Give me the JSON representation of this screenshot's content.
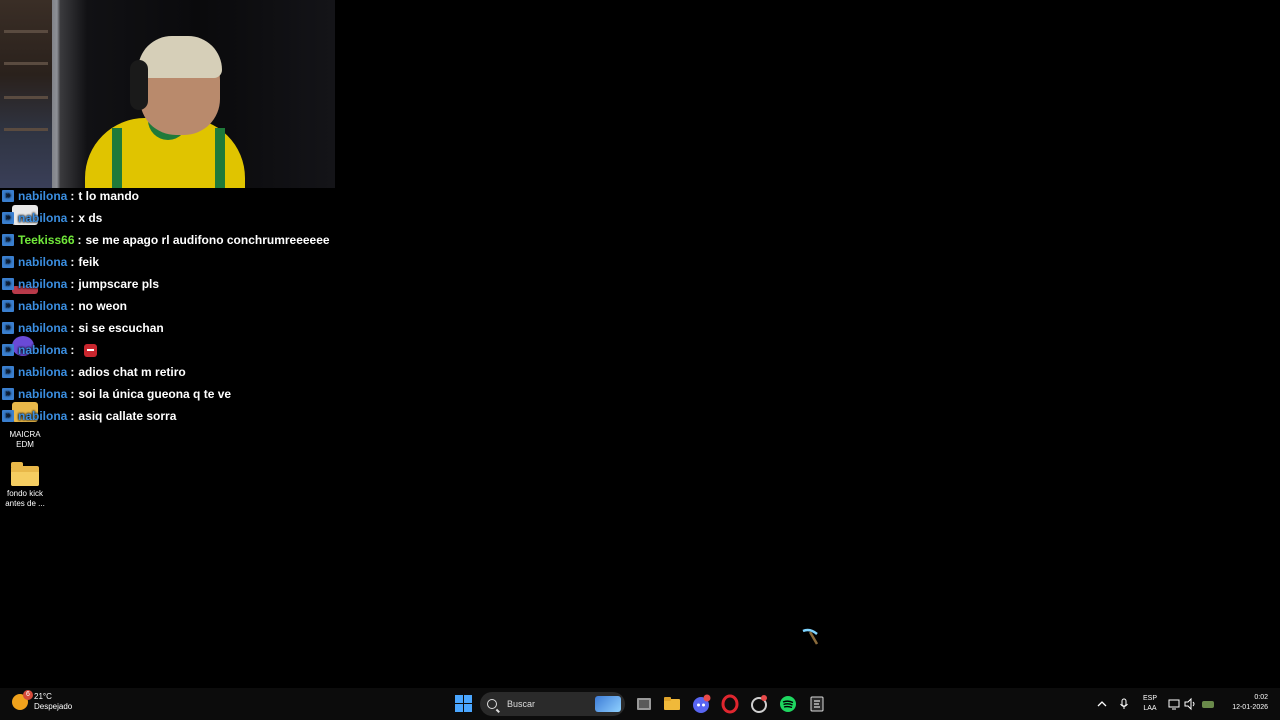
{
  "chat": {
    "messages": [
      {
        "user": "nabilona",
        "text": "t lo mando"
      },
      {
        "user": "nabilona",
        "text": "x ds"
      },
      {
        "user": "Teekiss66",
        "text": "se me apago rl audifono conchrumreeeeee"
      },
      {
        "user": "nabilona",
        "text": "feik"
      },
      {
        "user": "nabilona",
        "text": "jumpscare pls"
      },
      {
        "user": "nabilona",
        "text": "no weon"
      },
      {
        "user": "nabilona",
        "text": "si se escuchan"
      },
      {
        "user": "nabilona",
        "text": ""
      },
      {
        "user": "nabilona",
        "text": "adios chat m retiro"
      },
      {
        "user": "nabilona",
        "text": "soi la única gueona q te ve"
      },
      {
        "user": "nabilona",
        "text": "asiq callate sorra"
      }
    ],
    "separator": ":"
  },
  "desktop": {
    "icons": [
      {
        "label": "MAICRA EDM"
      },
      {
        "label": "fondo kick antes de ..."
      }
    ]
  },
  "taskbar": {
    "weather": {
      "temp": "21°C",
      "condition": "Despejado",
      "badge": "6"
    },
    "search_placeholder": "Buscar",
    "language": {
      "line1": "ESP",
      "line2": "LAA"
    },
    "clock": {
      "time": "0:02",
      "date": "12-01-2026"
    }
  },
  "colors": {
    "username_default": "#3b8ee0",
    "username_teekiss": "#71e83a",
    "taskbar_bg": "#0c0c0c"
  }
}
